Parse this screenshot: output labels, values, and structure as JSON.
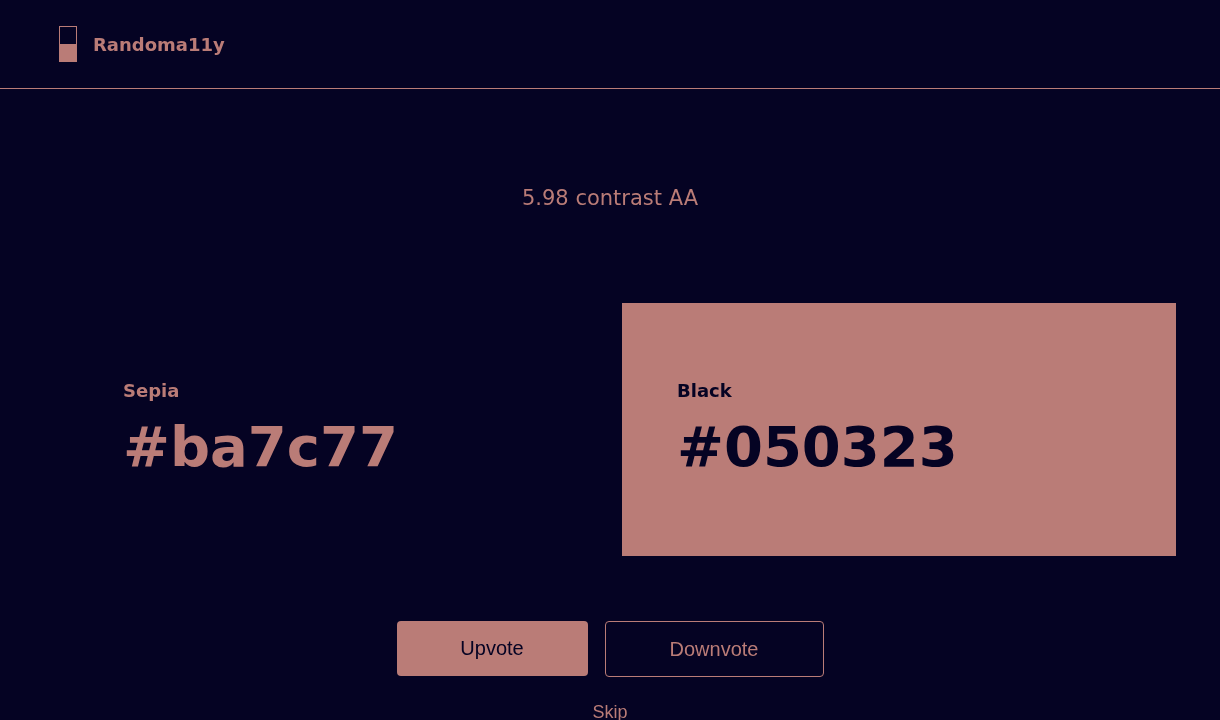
{
  "header": {
    "brand": "Randoma11y"
  },
  "contrast": "5.98 contrast AA",
  "swatches": [
    {
      "name": "Sepia",
      "hex": "#ba7c77",
      "filled": false
    },
    {
      "name": "Black",
      "hex": "#050323",
      "filled": true
    }
  ],
  "buttons": [
    {
      "label": "Upvote",
      "kind": "primary"
    },
    {
      "label": "Downvote",
      "kind": "outline"
    }
  ],
  "skip": "Skip"
}
